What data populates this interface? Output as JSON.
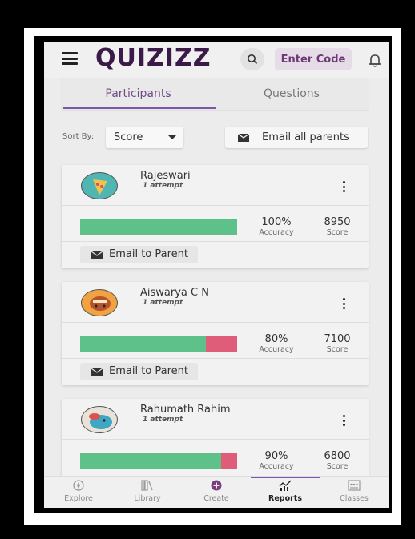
{
  "header": {
    "logo": "QUIZIZZ",
    "enter_code_label": "Enter Code",
    "icons": [
      "menu-icon",
      "search-icon",
      "bell-icon"
    ]
  },
  "tabs": [
    {
      "label": "Participants",
      "active": true
    },
    {
      "label": "Questions",
      "active": false
    }
  ],
  "sort": {
    "label": "Sort By:",
    "value": "Score"
  },
  "email_all_label": "Email all parents",
  "participants": [
    {
      "name": "Rajeswari",
      "attempts": "1 attempt",
      "accuracy": "100%",
      "accuracy_label": "Accuracy",
      "score": "8950",
      "score_label": "Score",
      "correct_fraction": 1.0,
      "email_label": "Email to Parent"
    },
    {
      "name": "Aiswarya C N",
      "attempts": "1 attempt",
      "accuracy": "80%",
      "accuracy_label": "Accuracy",
      "score": "7100",
      "score_label": "Score",
      "correct_fraction": 0.8,
      "email_label": "Email to Parent"
    },
    {
      "name": "Rahumath Rahim",
      "attempts": "1 attempt",
      "accuracy": "90%",
      "accuracy_label": "Accuracy",
      "score": "6800",
      "score_label": "Score",
      "correct_fraction": 0.9
    }
  ],
  "nav": [
    {
      "label": "Explore",
      "icon": "compass-icon",
      "active": false
    },
    {
      "label": "Library",
      "icon": "library-icon",
      "active": false
    },
    {
      "label": "Create",
      "icon": "plus-circle-icon",
      "active": false
    },
    {
      "label": "Reports",
      "icon": "reports-icon",
      "active": true
    },
    {
      "label": "Classes",
      "icon": "classes-icon",
      "active": false
    }
  ],
  "colors": {
    "accent": "#7a57a8",
    "brand": "#3b1a4a",
    "correct": "#5fc18a",
    "incorrect": "#e05d7a"
  }
}
